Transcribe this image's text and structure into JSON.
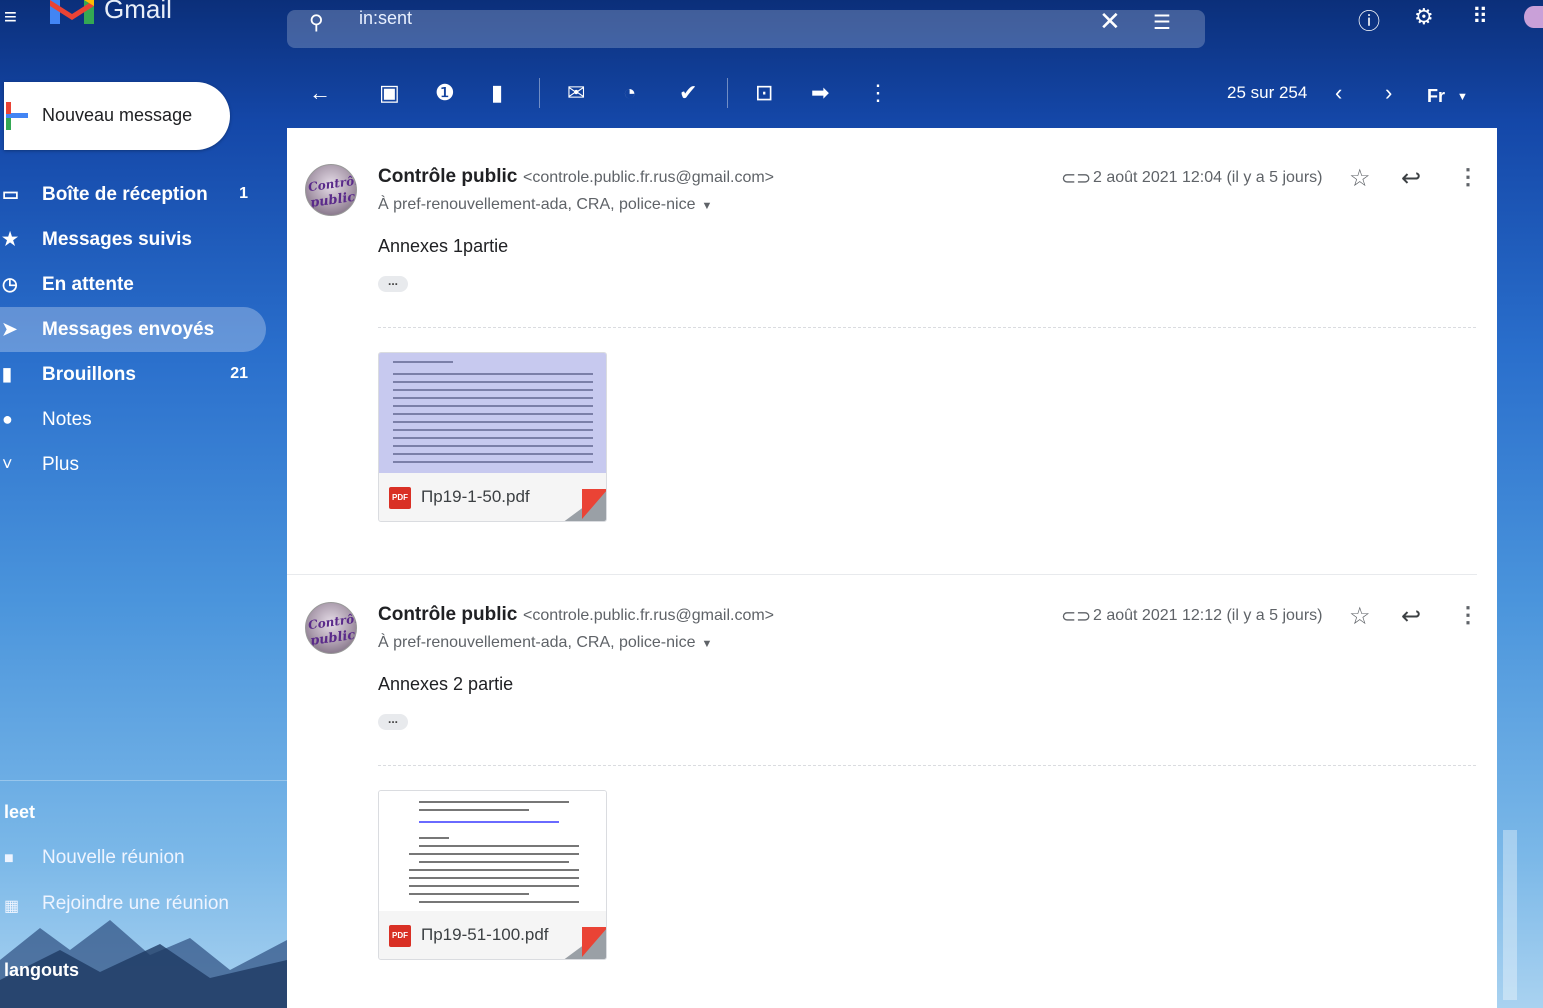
{
  "app": {
    "name": "Gmail"
  },
  "search": {
    "query": "in:sent"
  },
  "compose": {
    "label": "Nouveau message"
  },
  "nav": [
    {
      "label": "Boîte de réception",
      "count": "1",
      "icon": "inbox-icon"
    },
    {
      "label": "Messages suivis",
      "count": "",
      "icon": "star-icon"
    },
    {
      "label": "En attente",
      "count": "",
      "icon": "clock-icon"
    },
    {
      "label": "Messages envoyés",
      "count": "",
      "icon": "send-icon",
      "active": true
    },
    {
      "label": "Brouillons",
      "count": "21",
      "icon": "draft-icon"
    },
    {
      "label": "Notes",
      "count": "",
      "icon": "label-icon"
    },
    {
      "label": "Plus",
      "count": "",
      "icon": "chevron-down-icon"
    }
  ],
  "meet": {
    "title": "leet",
    "new_meeting": "Nouvelle réunion",
    "join_meeting": "Rejoindre une réunion"
  },
  "hangouts": {
    "title": "langouts"
  },
  "toolbar": {
    "pager": "25 sur 254",
    "lang": "Fr"
  },
  "messages": [
    {
      "sender_name": "Contrôle public",
      "sender_email": "<controle.public.fr.rus@gmail.com>",
      "recipients": "À pref-renouvellement-ada, CRA, police-nice",
      "date": "2 août 2021 12:04 (il y a 5 jours)",
      "body": "Annexes 1partie",
      "attachment": "Пр19-1-50.pdf",
      "avatar_line1": "Contrôle",
      "avatar_line2": "public"
    },
    {
      "sender_name": "Contrôle public",
      "sender_email": "<controle.public.fr.rus@gmail.com>",
      "recipients": "À pref-renouvellement-ada, CRA, police-nice",
      "date": "2 août 2021 12:12 (il y a 5 jours)",
      "body": "Annexes 2 partie",
      "attachment": "Пр19-51-100.pdf",
      "avatar_line1": "Contrôle",
      "avatar_line2": "public"
    }
  ],
  "colors": {
    "accent": "#1a56b8",
    "pdf": "#d93025"
  }
}
